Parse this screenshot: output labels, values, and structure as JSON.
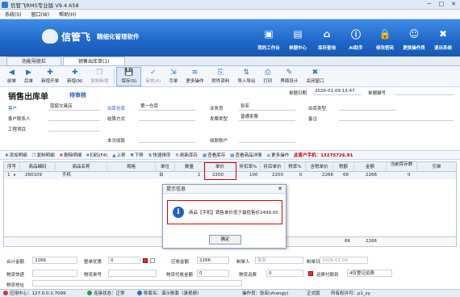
{
  "window": {
    "title": "信管飞RMS专业版 V9.4.658",
    "minimize": "─",
    "maximize": "□",
    "close": "✕"
  },
  "menu": [
    "系统(S)",
    "窗口(W)",
    "帮助(H)"
  ],
  "banner": {
    "brand": "信管飞",
    "slogan": "精细化管理软件",
    "nav": [
      {
        "label": "我的工作台",
        "icon": "monitor-icon",
        "glyph": "▣"
      },
      {
        "label": "单据中心",
        "icon": "documents-icon",
        "glyph": "▤"
      },
      {
        "label": "库存查询",
        "icon": "warehouse-icon",
        "glyph": "⌂"
      },
      {
        "label": "AI助手",
        "icon": "info-icon",
        "glyph": "ⓘ"
      },
      {
        "label": "修改密码",
        "icon": "lock-icon",
        "glyph": "🔒"
      },
      {
        "label": "更换操作员",
        "icon": "user-icon",
        "glyph": "☺"
      },
      {
        "label": "退出系统",
        "icon": "close-icon",
        "glyph": "✖"
      }
    ]
  },
  "tabs": [
    {
      "label": "功能导航栏"
    },
    {
      "label": "销售出库单(1)"
    }
  ],
  "toolbar": [
    {
      "label": "前单",
      "glyph": "◀"
    },
    {
      "label": "后单",
      "glyph": "▶"
    },
    {
      "label": "新增开单",
      "glyph": "✚"
    },
    {
      "label": "新增(N)",
      "glyph": "✚"
    },
    {
      "label": "复制新增",
      "glyph": "❐"
    },
    {
      "label": "保存(S)",
      "glyph": "💾"
    },
    {
      "label": "审核(A)",
      "glyph": "✔"
    },
    {
      "label": "引单",
      "glyph": "⇲"
    },
    {
      "label": "更多操作",
      "glyph": "≡"
    },
    {
      "label": "附件资料",
      "glyph": "⎘"
    },
    {
      "label": "导入导出",
      "glyph": "⇅"
    },
    {
      "label": "打印",
      "glyph": "⎙"
    },
    {
      "label": "界面设计",
      "glyph": "✎"
    },
    {
      "label": "关闭窗口",
      "glyph": "✖"
    }
  ],
  "form": {
    "title": "销售出库单",
    "status": "待审核",
    "date_label": "单据日期",
    "date_value": "2026-01-09 13:47",
    "number_label": "单据编号",
    "customer_label": "客户",
    "customer_value": "蓝狐文具店",
    "warehouse_label": "出库仓库",
    "warehouse_value": "第一仓库",
    "clerk_label": "业务员",
    "clerk_value": "张亚",
    "outtype_label": "出库类型",
    "contact_label": "客户联系人",
    "settle_label": "结算方式",
    "invoice_label": "发票类型",
    "invoice_value": "普通发票",
    "remark_label": "备注",
    "project_label": "工程项目",
    "receive_label": "本次收款",
    "account_label": "收款账户"
  },
  "gridtoolbar": {
    "items": [
      "添加明细",
      "复制明细",
      "删除明细",
      "扫码(F4)",
      "上移",
      "下移",
      "快速排序",
      "刷新库存",
      "查看库存",
      "查看商品详情",
      "更多操作"
    ],
    "customer_info": "此客户手机：13275726.91"
  },
  "grid": {
    "columns": [
      "序号",
      "商品编码",
      "商品名称",
      "规格",
      "单位",
      "数量",
      "单价",
      "折扣率%",
      "折后单价",
      "税率%",
      "含税单价",
      "税额",
      "金额",
      "当前库存数",
      "引单"
    ],
    "rows": [
      {
        "no": "1",
        "code": "260109",
        "name": "手机",
        "unit": "台",
        "qty": "1",
        "price": "2200",
        "discount": "100",
        "disc_price": "2200",
        "tax_rate": "0",
        "tax_price": "2266",
        "tax": "66",
        "amount": "2266",
        "stock": "0"
      }
    ],
    "footer": {
      "tax": "66",
      "amount": "2266"
    }
  },
  "dialog": {
    "title": "提示信息",
    "message": "商品【手机】销售单价低于最低售价2499.00",
    "ok": "确定",
    "close": "✕"
  },
  "summary": {
    "total_label": "合计金额",
    "total_value": "2266",
    "discount_label": "整单优惠",
    "discount_value": "0",
    "receivable_label": "应收金额",
    "receivable_value": "2266",
    "maker_label": "制单人",
    "maker_value": "张亚",
    "makedate_label": "制单日期",
    "makedate_value": "2026-01-09",
    "logistics_label": "物流快递",
    "logistics_no_label": "物流单号",
    "freight_label": "物流代收金额",
    "freight_value": "0",
    "shipping_label": "物流运费",
    "shipping_value": "0",
    "print_label": "运费付款到",
    "print_value": "4仅登记运费",
    "payer_label": "物流地址"
  },
  "statusbar": {
    "app": "应用中心：127.0.0.1:7099",
    "conn": "连接状态：正常",
    "account": "账套名：演示账套（录视频）",
    "operator": "操作员：张亚(zhangy)",
    "version": "正式版",
    "license": "所有权许可：p1_zy"
  }
}
